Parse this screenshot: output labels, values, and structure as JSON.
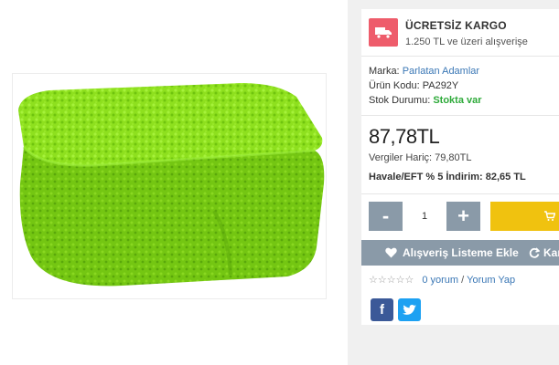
{
  "product": {
    "image_alt": "green microfiber sponge"
  },
  "shipping": {
    "title": "ÜCRETSİZ KARGO",
    "subtitle": "1.250 TL ve üzeri alışverişe",
    "icon": "truck-icon"
  },
  "meta": {
    "brand_label": "Marka:",
    "brand_value": "Parlatan Adamlar",
    "code_label": "Ürün Kodu:",
    "code_value": "PA292Y",
    "stock_label": "Stok Durumu:",
    "stock_value": "Stokta var"
  },
  "price": {
    "main": "87,78TL",
    "tax_free": "Vergiler Hariç: 79,80TL",
    "eft": "Havale/EFT % 5 İndirim: 82,65 TL"
  },
  "quantity": {
    "minus": "-",
    "value": "1",
    "plus": "+"
  },
  "actions": {
    "wishlist": "Alışveriş Listeme Ekle",
    "compare": "Kar"
  },
  "rating": {
    "stars": "☆☆☆☆☆",
    "reviews": "0 yorum",
    "separator": "/",
    "write": "Yorum Yap"
  },
  "social": {
    "facebook": "f"
  },
  "colors": {
    "accent_yellow": "#f0c20f",
    "shipping_red": "#ee5c6b",
    "slate_button": "#8a9aa8",
    "link_blue": "#3a77b5",
    "stock_green": "#2eaa3a",
    "facebook": "#3b5998",
    "twitter": "#1da1f2"
  }
}
